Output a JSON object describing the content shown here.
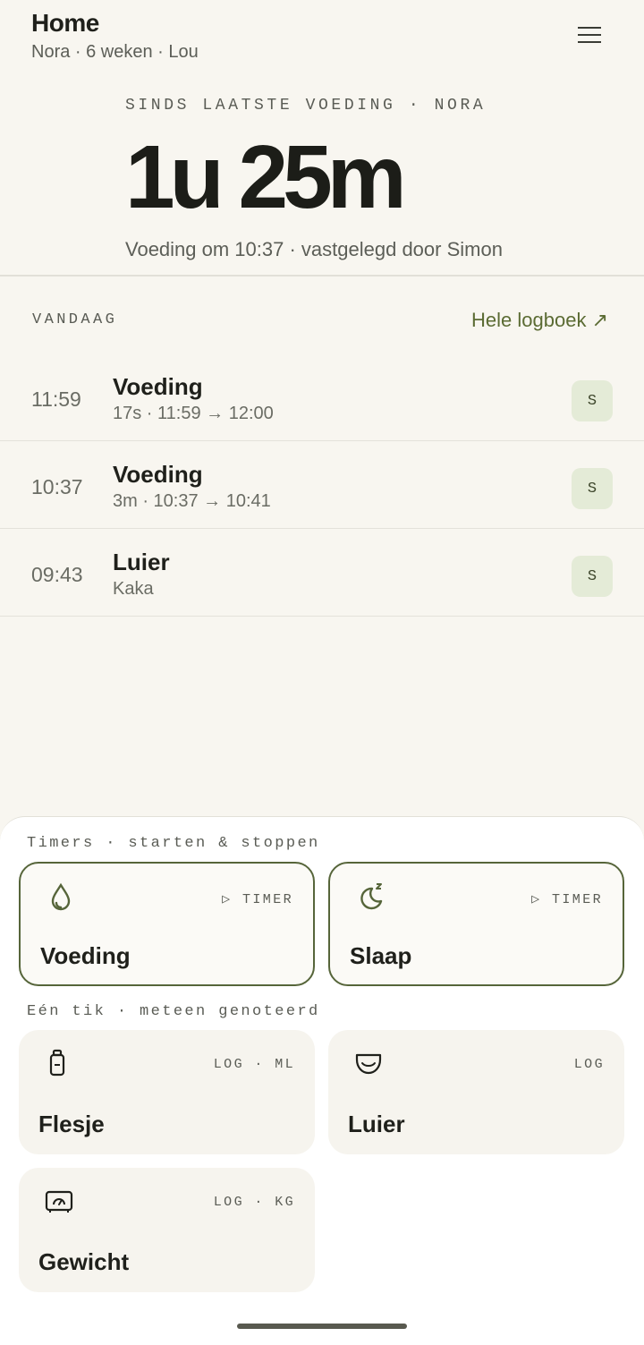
{
  "header": {
    "title": "Home",
    "subtitle": "Nora · 6 weken · Lou"
  },
  "hero": {
    "eyebrow": "SINDS LAATSTE VOEDING · NORA",
    "elapsed": "1u 25m",
    "detail": "Voeding om 10:37 · vastgelegd door Simon"
  },
  "today": {
    "label": "VANDAAG",
    "link": "Hele logboek ↗",
    "entries": [
      {
        "time": "11:59",
        "title": "Voeding",
        "meta": "17s · 11:59 → 12:00",
        "badge": "S"
      },
      {
        "time": "10:37",
        "title": "Voeding",
        "meta": "3m · 10:37 → 10:41",
        "badge": "S"
      },
      {
        "time": "09:43",
        "title": "Luier",
        "meta": "Kaka",
        "badge": "S"
      }
    ]
  },
  "timers": {
    "label": "Timers · starten & stoppen",
    "items": [
      {
        "name": "Voeding",
        "tag": "▷ TIMER",
        "icon": "drop-icon"
      },
      {
        "name": "Slaap",
        "tag": "▷ TIMER",
        "icon": "moon-sleep-icon"
      }
    ]
  },
  "quick": {
    "label": "Eén tik · meteen genoteerd",
    "items": [
      {
        "name": "Flesje",
        "tag": "LOG · ML",
        "icon": "bottle-icon"
      },
      {
        "name": "Luier",
        "tag": "LOG",
        "icon": "diaper-icon"
      },
      {
        "name": "Gewicht",
        "tag": "LOG · KG",
        "icon": "scale-icon"
      }
    ]
  },
  "colors": {
    "accent": "#56653a",
    "badge_bg": "#e4ebd7",
    "background": "#f8f6f0"
  }
}
